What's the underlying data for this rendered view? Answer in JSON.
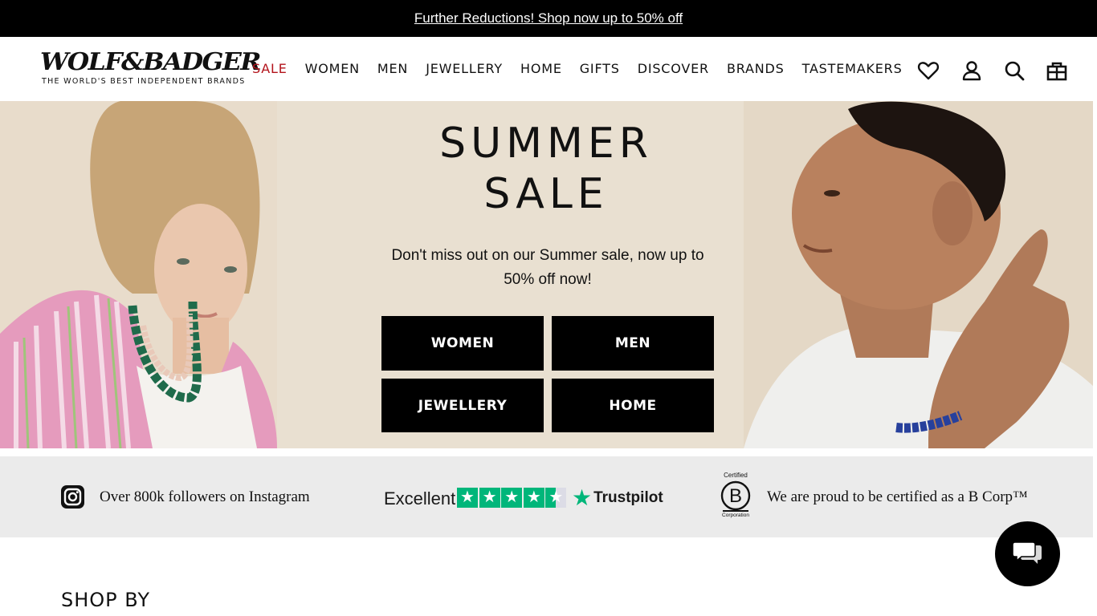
{
  "promo": {
    "text": "Further Reductions! Shop now up to 50% off"
  },
  "header": {
    "logo_word": "WOLF&BADGER",
    "logo_tagline": "THE WORLD'S BEST INDEPENDENT BRANDS",
    "nav": [
      "SALE",
      "WOMEN",
      "MEN",
      "JEWELLERY",
      "HOME",
      "GIFTS",
      "DISCOVER",
      "BRANDS",
      "TASTEMAKERS"
    ],
    "icons": [
      "heart-icon",
      "account-icon",
      "search-icon",
      "bag-icon"
    ]
  },
  "hero": {
    "title_line1": "SUMMER",
    "title_line2": "SALE",
    "subtitle": "Don't miss out on our Summer sale, now up to 50% off now!",
    "buttons": [
      "WOMEN",
      "MEN",
      "JEWELLERY",
      "HOME"
    ]
  },
  "trust": {
    "instagram_text": "Over 800k followers on Instagram",
    "trustpilot_rating_word": "Excellent",
    "trustpilot_stars": 4.5,
    "trustpilot_brand": "Trustpilot",
    "bcorp_certified": "Certified",
    "bcorp_corporation": "Corporation",
    "bcorp_text": "We are proud to be certified as a B Corp™"
  },
  "section": {
    "shop_by": "SHOP BY"
  },
  "colors": {
    "sale_red": "#b3131b",
    "trustpilot_green": "#00b67a",
    "hero_beige": "#e9e0d1",
    "trust_bg": "#ebebeb"
  }
}
